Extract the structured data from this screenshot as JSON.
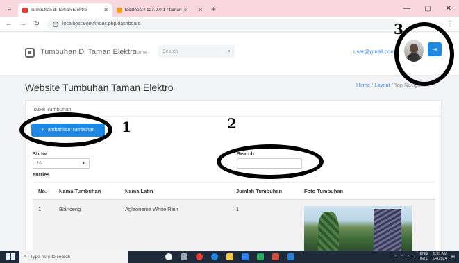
{
  "browser": {
    "tabs": [
      {
        "title": "Tumbuhan di Taman Elektro",
        "active": true,
        "favicon_color": "#e53935"
      },
      {
        "title": "localhost / 127.0.0.1 / taman_el",
        "active": false,
        "favicon_color": "#f59e0b"
      }
    ],
    "url": "localhost:8080/index.php/dashboard"
  },
  "navbar": {
    "brand": "Tumbuhan Di Taman Elektro",
    "home": "Home",
    "search_placeholder": "Search",
    "user_email": "user@gmail.com"
  },
  "page": {
    "title": "Website Tumbuhan Taman Elektro",
    "breadcrumb": [
      "Home",
      "Layout",
      "Top Navigation"
    ]
  },
  "card": {
    "header": "Tabel Tumbuhan",
    "add_button": "+ Tambahkan Tumbuhan",
    "show_label": "Show",
    "entries_value": "10",
    "entries_label": "entries",
    "search_label": "Search:"
  },
  "table": {
    "columns": [
      "No.",
      "Nama Tumbuhan",
      "Nama Latin",
      "Jumlah Tumbuhan",
      "Foto Tumbuhan"
    ],
    "rows": [
      {
        "no": "1",
        "nama": "Blanceng",
        "latin": "Aglaonema White Rain",
        "jumlah": "1"
      }
    ]
  },
  "annotations": {
    "one": "1",
    "two": "2",
    "three": "3"
  },
  "taskbar": {
    "search_placeholder": "Type here to search",
    "lang": "ENG",
    "region": "INTL",
    "time": "5:35 AM",
    "date": "1/4/2024"
  },
  "colors": {
    "primary": "#1e88e5",
    "link": "#3b82f6",
    "tabbar": "#f8d7df"
  }
}
